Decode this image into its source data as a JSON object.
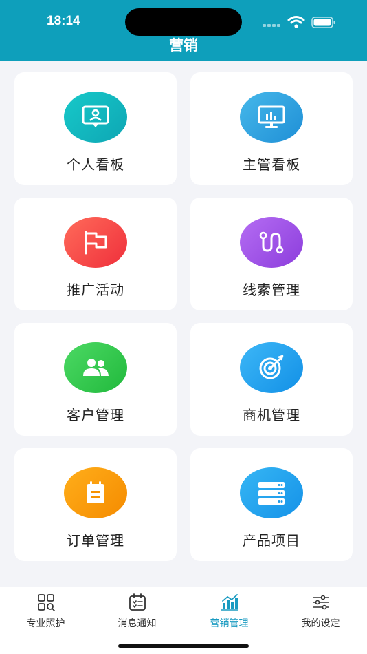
{
  "status_bar": {
    "time": "18:14"
  },
  "header": {
    "title": "营销"
  },
  "colors": {
    "header_bg": "#0e9fbb",
    "tab_active": "#1a9bc1"
  },
  "cards": [
    {
      "label": "个人看板",
      "icon": "person-board-icon",
      "gradient": [
        "#17c9c9",
        "#0ea6b4"
      ]
    },
    {
      "label": "主管看板",
      "icon": "monitor-chart-icon",
      "gradient": [
        "#46b8ea",
        "#1f8fd6"
      ]
    },
    {
      "label": "推广活动",
      "icon": "flag-icon",
      "gradient": [
        "#ff6b5a",
        "#ef2f3b"
      ]
    },
    {
      "label": "线索管理",
      "icon": "route-icon",
      "gradient": [
        "#b56df3",
        "#8c3ddc"
      ]
    },
    {
      "label": "客户管理",
      "icon": "users-icon",
      "gradient": [
        "#4cd964",
        "#21b93c"
      ]
    },
    {
      "label": "商机管理",
      "icon": "target-icon",
      "gradient": [
        "#3db7f7",
        "#1290e6"
      ]
    },
    {
      "label": "订单管理",
      "icon": "clipboard-icon",
      "gradient": [
        "#ffae1a",
        "#f58b00"
      ]
    },
    {
      "label": "产品项目",
      "icon": "server-icon",
      "gradient": [
        "#36b6f4",
        "#1592e8"
      ]
    }
  ],
  "tabs": [
    {
      "label": "专业照护",
      "icon": "grid-search-icon",
      "active": false
    },
    {
      "label": "消息通知",
      "icon": "calendar-list-icon",
      "active": false
    },
    {
      "label": "营销管理",
      "icon": "bar-chart-icon",
      "active": true
    },
    {
      "label": "我的设定",
      "icon": "sliders-icon",
      "active": false
    }
  ]
}
